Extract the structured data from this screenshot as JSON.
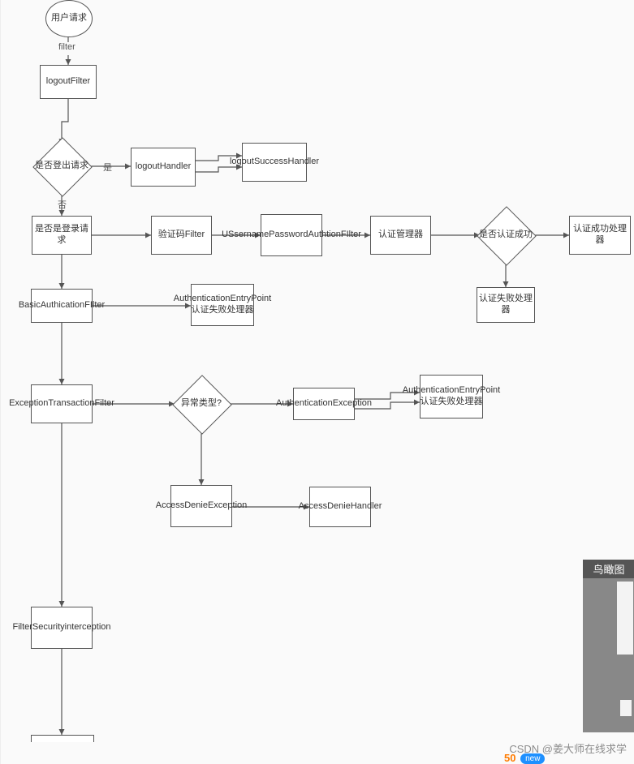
{
  "diagram": {
    "start": "用户请求",
    "f_filter": "filter",
    "n_logoutFilter": "logoutFilter",
    "d_isLogout": "是否登出请求",
    "l_yes": "是",
    "l_no": "否",
    "n_logoutHandler": "logoutHandler",
    "n_logoutSuccessHandler": "logoutSuccessHandler",
    "d_isLogin": "是否是登录请求",
    "n_captchaFilter": "验证码Filter",
    "n_upFilter": "USsernamePasswordAuthtionFIlter",
    "n_authManager": "认证管理器",
    "d_authOk": "是否认证成功",
    "n_successHandler": "认证成功处理器",
    "n_failureHandler": "认证失败处理器",
    "n_basicAuth": "BasicAuthicationFIlter",
    "n_authEntryPoint1": "AuthenticationEntryPoint认证失败处理器",
    "n_exceptionFilter": "ExceptionTransactionFilter",
    "d_excType": "异常类型?",
    "n_authException": "AuthenticationException",
    "n_authEntryPoint2": "AuthenticationEntryPoint认证失败处理器",
    "n_accessDeniedEx": "AccessDenieException",
    "n_accessDeniedHandler": "AccessDenieHandler",
    "n_filterSecurity": "FilterSecurityinterception"
  },
  "ui": {
    "minimap_title": "鸟瞰图",
    "credit_prefix": "CSDN @",
    "credit_author": "姜大师在线求学",
    "orange_num": "50",
    "badge": "new"
  }
}
